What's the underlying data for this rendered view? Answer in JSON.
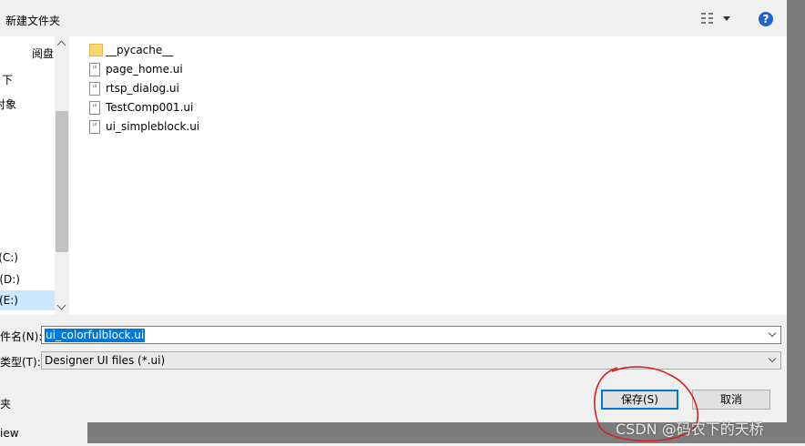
{
  "toolbar": {
    "new_folder_label": "新建文件夹",
    "help_glyph": "?"
  },
  "nav": {
    "items": [
      {
        "label": "阅盘"
      },
      {
        "label": "下"
      },
      {
        "label": "对象"
      },
      {
        "label": "(C:)"
      },
      {
        "label": "(D:)"
      },
      {
        "label": "(E:)"
      }
    ]
  },
  "files": [
    {
      "name": "__pycache__",
      "type": "folder"
    },
    {
      "name": "page_home.ui",
      "type": "ui",
      "icon_text": "ui"
    },
    {
      "name": "rtsp_dialog.ui",
      "type": "ui",
      "icon_text": "ui"
    },
    {
      "name": "TestComp001.ui",
      "type": "ui",
      "icon_text": "ui"
    },
    {
      "name": "ui_simpleblock.ui",
      "type": "ui",
      "icon_text": "ui"
    }
  ],
  "filename": {
    "label": "件名(N):",
    "value": "ui_colorfulblock.ui"
  },
  "filetype": {
    "label": "类型(T):",
    "value": "Designer UI files (*.ui)"
  },
  "hide_folders_label": "夹",
  "buttons": {
    "save": "保存(S)",
    "cancel": "取消"
  },
  "background": {
    "view_label": "iew"
  },
  "watermark": "CSDN @码农下的天桥",
  "colors": {
    "accent": "#0078d7",
    "annotation": "#d42020"
  }
}
